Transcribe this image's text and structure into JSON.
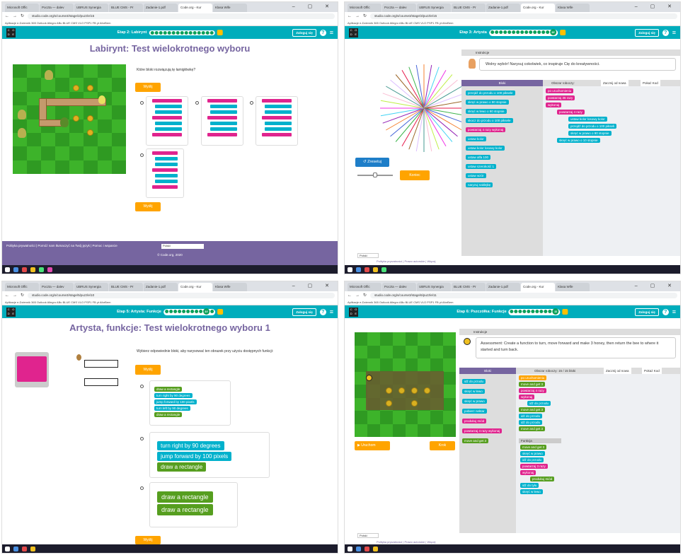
{
  "s1": {
    "tabs": [
      "Microsoft Offic",
      "Poczta — dalev",
      "UBRUS Synergia",
      "BLUE CMS - Pr",
      "Zadanie-1.pdf",
      "Code.org - Kur",
      "Klasa Wife"
    ],
    "url": "studio.code.org/s/course3/stage/2/puzzle/15",
    "bookmarks": "Aplikacje  e-Dziennik  365  Outlook  Allegro  ABu  BLUE CMS  VLO  PSP1  FB  yt  AforBem",
    "stage_label": "Etap 2: Labirynt",
    "signin": "Zaloguj się",
    "title": "Labirynt: Test wielokrotnego wyboru",
    "question": "Które bloki rozwiązują tę łamigłówkę?",
    "submit": "Wyślij",
    "footer_links": "Polityka prywatności | Pomóż nam tłumaczyć na Twój język | Pomoc i wsparcie",
    "footer_lang": "Polski",
    "footer_cr": "© Code.org, 2020"
  },
  "s2": {
    "url": "studio.code.org/s/course3/stage/3/puzzle/15",
    "stage_label": "Etap 3: Artysta",
    "stage_num": "15",
    "signin": "Zaloguj się",
    "instr_label": "Instrukcje",
    "instruction": "Wolny wybór! Narysuj cokolwiek, co inspiruje Cię do kreatywności.",
    "bloki": "Bloki",
    "workspace": "Obszar roboczy:",
    "restart": "Zacznij od nowa",
    "show_code": "Pokaż Kod",
    "reset": "Zresetuj",
    "finish": "Koniec",
    "toolbox": [
      "przejdź do przodu o 100 piksele",
      "skręć w prawo o 90 stopnie",
      "skręć w lewo o 90 stopnie",
      "skocz do przodu o 100 piksele",
      "powtarzaj 4 razy wykonaj",
      "ustaw kolor",
      "ustaw kolor losowy kolor",
      "ustaw alfa 100",
      "ustaw szerokość 1",
      "ustaw wzór",
      "naryzuj naklejkę"
    ],
    "program": [
      "po uruchomieniu",
      "powtarzaj 36 razy",
      "wykonaj",
      "powtarzaj 4 razy",
      "ustaw kolor losowy kolor",
      "przejdź do przodu o 100 pikseli",
      "skręć w prawo o 90 stopnie",
      "skręć w prawo o 10 stopnie"
    ],
    "footer": "Polityka prywatności | Prawo autorskie | Więcej"
  },
  "s3": {
    "url": "studio.code.org/s/course3/stage/5/puzzle/10",
    "stage_label": "Etap 5: Artysta: Funkcje",
    "stage_num": "10",
    "signin": "Zaloguj się",
    "title": "Artysta, funkcje: Test wielokrotnego wyboru 1",
    "question": "Wybierz odpowiednie bloki, aby narysować ten obrazek przy użyciu dostępnych funkcji:",
    "submit": "Wyślij",
    "opt1": [
      "draw a rectangle",
      "turn right by 90 degrees",
      "jump forward by 100 pixels",
      "turn left by 90 degrees",
      "draw a rectangle"
    ],
    "opt2": [
      "turn right by 90 degrees",
      "jump forward by 100 pixels",
      "draw a rectangle"
    ],
    "opt3": [
      "draw a rectangle",
      "draw a rectangle"
    ]
  },
  "s4": {
    "url": "studio.code.org/s/course3/stage/6/puzzle/11",
    "stage_label": "Etap 6: Pszczółka: Funkcje",
    "stage_num": "11",
    "signin": "Zaloguj się",
    "instr_label": "Instrukcje",
    "instruction": "Assessment: Create a function to turn, move forward and make 3 honey, then return the bee to where it started and turn back.",
    "bloki": "Bloki",
    "workspace": "Obszar roboczy: 15 / 15 bloki",
    "restart": "Zacznij od nowa",
    "show_code": "Pokaż Kod",
    "run": "Uruchom",
    "step": "Krok",
    "toolbox": [
      "idź do przodu",
      "skręć w lewo",
      "skręć w prawo",
      "pobierz nektar",
      "produkuj miód",
      "powtarzaj 4 razy wykonaj",
      "move and get 3"
    ],
    "program": [
      "po uruchomieniu",
      "move and get 3",
      "powtarzaj 4 razy",
      "wykonaj",
      "idź do przodu",
      "move and get 3",
      "idź do przodu",
      "idź do przodu",
      "move and get 3"
    ],
    "func_label": "Funkcja",
    "func": [
      "move and get 3",
      "skręć w prawo",
      "idź do przodu",
      "powtarzaj 3 razy",
      "wykonaj",
      "produkuj miód",
      "idź do tyłu",
      "skręć w lewo"
    ],
    "lang": "Polski",
    "footer": "Polityka prywatności | Prawo autorskie | Więcej"
  }
}
